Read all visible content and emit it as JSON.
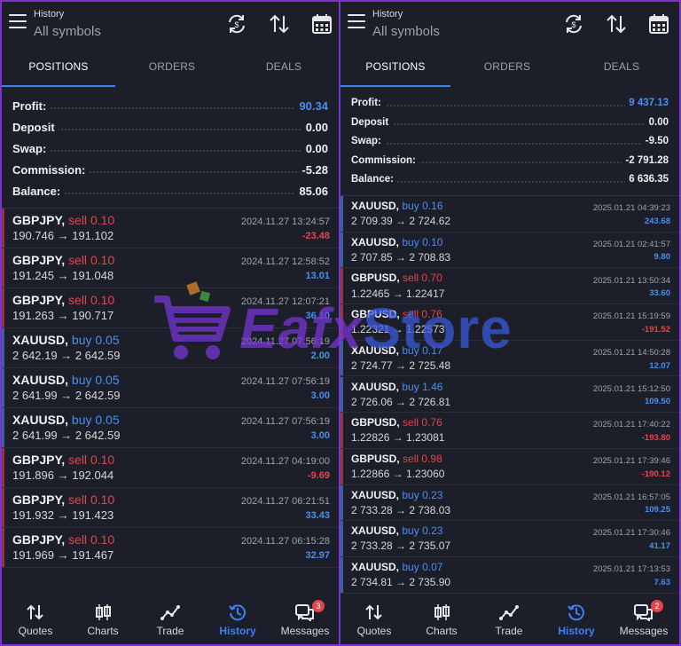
{
  "colors": {
    "sell": "#e4454a",
    "buy": "#4a8ff0",
    "accent": "#3b82f6",
    "frame": "#7a35d0"
  },
  "watermark": {
    "text1": "Eafx",
    "text2": "Store"
  },
  "left": {
    "header": {
      "title": "History",
      "subtitle": "All symbols"
    },
    "tabs": [
      "POSITIONS",
      "ORDERS",
      "DEALS"
    ],
    "summary": [
      {
        "label": "Profit:",
        "value": "90.34",
        "blue": true
      },
      {
        "label": "Deposit",
        "value": "0.00",
        "blue": false
      },
      {
        "label": "Swap:",
        "value": "0.00",
        "blue": false
      },
      {
        "label": "Commission:",
        "value": "-5.28",
        "blue": false
      },
      {
        "label": "Balance:",
        "value": "85.06",
        "blue": false
      }
    ],
    "deals": [
      {
        "symbol": "GBPJPY,",
        "side": "sell",
        "lot": "0.10",
        "prices": "190.746 → 191.102",
        "time": "2024.11.27 13:24:57",
        "pl": "-23.48"
      },
      {
        "symbol": "GBPJPY,",
        "side": "sell",
        "lot": "0.10",
        "prices": "191.245 → 191.048",
        "time": "2024.11.27 12:58:52",
        "pl": "13.01"
      },
      {
        "symbol": "GBPJPY,",
        "side": "sell",
        "lot": "0.10",
        "prices": "191.263 → 190.717",
        "time": "2024.11.27 12:07:21",
        "pl": "36.10"
      },
      {
        "symbol": "XAUUSD,",
        "side": "buy",
        "lot": "0.05",
        "prices": "2 642.19 → 2 642.59",
        "time": "2024.11.27 07:56:19",
        "pl": "2.00"
      },
      {
        "symbol": "XAUUSD,",
        "side": "buy",
        "lot": "0.05",
        "prices": "2 641.99 → 2 642.59",
        "time": "2024.11.27 07:56:19",
        "pl": "3.00"
      },
      {
        "symbol": "XAUUSD,",
        "side": "buy",
        "lot": "0.05",
        "prices": "2 641.99 → 2 642.59",
        "time": "2024.11.27 07:56:19",
        "pl": "3.00"
      },
      {
        "symbol": "GBPJPY,",
        "side": "sell",
        "lot": "0.10",
        "prices": "191.896 → 192.044",
        "time": "2024.11.27 04:19:00",
        "pl": "-9.69"
      },
      {
        "symbol": "GBPJPY,",
        "side": "sell",
        "lot": "0.10",
        "prices": "191.932 → 191.423",
        "time": "2024.11.27 06:21:51",
        "pl": "33.43"
      },
      {
        "symbol": "GBPJPY,",
        "side": "sell",
        "lot": "0.10",
        "prices": "191.969 → 191.467",
        "time": "2024.11.27 06:15:28",
        "pl": "32.97"
      }
    ],
    "nav": [
      {
        "label": "Quotes",
        "icon": "quotes-icon"
      },
      {
        "label": "Charts",
        "icon": "charts-icon"
      },
      {
        "label": "Trade",
        "icon": "trade-icon"
      },
      {
        "label": "History",
        "icon": "history-icon",
        "active": true
      },
      {
        "label": "Messages",
        "icon": "messages-icon",
        "badge": "3"
      }
    ]
  },
  "right": {
    "header": {
      "title": "History",
      "subtitle": "All symbols"
    },
    "tabs": [
      "POSITIONS",
      "ORDERS",
      "DEALS"
    ],
    "summary": [
      {
        "label": "Profit:",
        "value": "9 437.13",
        "blue": true
      },
      {
        "label": "Deposit",
        "value": "0.00",
        "blue": false
      },
      {
        "label": "Swap:",
        "value": "-9.50",
        "blue": false
      },
      {
        "label": "Commission:",
        "value": "-2 791.28",
        "blue": false
      },
      {
        "label": "Balance:",
        "value": "6 636.35",
        "blue": false
      }
    ],
    "deals": [
      {
        "symbol": "XAUUSD,",
        "side": "buy",
        "lot": "0.16",
        "prices": "2 709.39 → 2 724.62",
        "time": "2025.01.21 04:39:23",
        "pl": "243.68"
      },
      {
        "symbol": "XAUUSD,",
        "side": "buy",
        "lot": "0.10",
        "prices": "2 707.85 → 2 708.83",
        "time": "2025.01.21 02:41:57",
        "pl": "9.80"
      },
      {
        "symbol": "GBPUSD,",
        "side": "sell",
        "lot": "0.70",
        "prices": "1.22465 → 1.22417",
        "time": "2025.01.21 13:50:34",
        "pl": "33.60"
      },
      {
        "symbol": "GBPUSD,",
        "side": "sell",
        "lot": "0.76",
        "prices": "1.22321 → 1.22573",
        "time": "2025.01.21 15:19:59",
        "pl": "-191.52"
      },
      {
        "symbol": "XAUUSD,",
        "side": "buy",
        "lot": "0.17",
        "prices": "2 724.77 → 2 725.48",
        "time": "2025.01.21 14:50:28",
        "pl": "12.07"
      },
      {
        "symbol": "XAUUSD,",
        "side": "buy",
        "lot": "1.46",
        "prices": "2 726.06 → 2 726.81",
        "time": "2025.01.21 15:12:50",
        "pl": "109.50"
      },
      {
        "symbol": "GBPUSD,",
        "side": "sell",
        "lot": "0.76",
        "prices": "1.22826 → 1.23081",
        "time": "2025.01.21 17:40:22",
        "pl": "-193.80"
      },
      {
        "symbol": "GBPUSD,",
        "side": "sell",
        "lot": "0.98",
        "prices": "1.22866 → 1.23060",
        "time": "2025.01.21 17:39:46",
        "pl": "-190.12"
      },
      {
        "symbol": "XAUUSD,",
        "side": "buy",
        "lot": "0.23",
        "prices": "2 733.28 → 2 738.03",
        "time": "2025.01.21 16:57:05",
        "pl": "109.25"
      },
      {
        "symbol": "XAUUSD,",
        "side": "buy",
        "lot": "0.23",
        "prices": "2 733.28 → 2 735.07",
        "time": "2025.01.21 17:30:46",
        "pl": "41.17"
      },
      {
        "symbol": "XAUUSD,",
        "side": "buy",
        "lot": "0.07",
        "prices": "2 734.81 → 2 735.90",
        "time": "2025.01.21 17:13:53",
        "pl": "7.63"
      }
    ],
    "nav": [
      {
        "label": "Quotes",
        "icon": "quotes-icon"
      },
      {
        "label": "Charts",
        "icon": "charts-icon"
      },
      {
        "label": "Trade",
        "icon": "trade-icon"
      },
      {
        "label": "History",
        "icon": "history-icon",
        "active": true
      },
      {
        "label": "Messages",
        "icon": "messages-icon",
        "badge": "2"
      }
    ]
  }
}
